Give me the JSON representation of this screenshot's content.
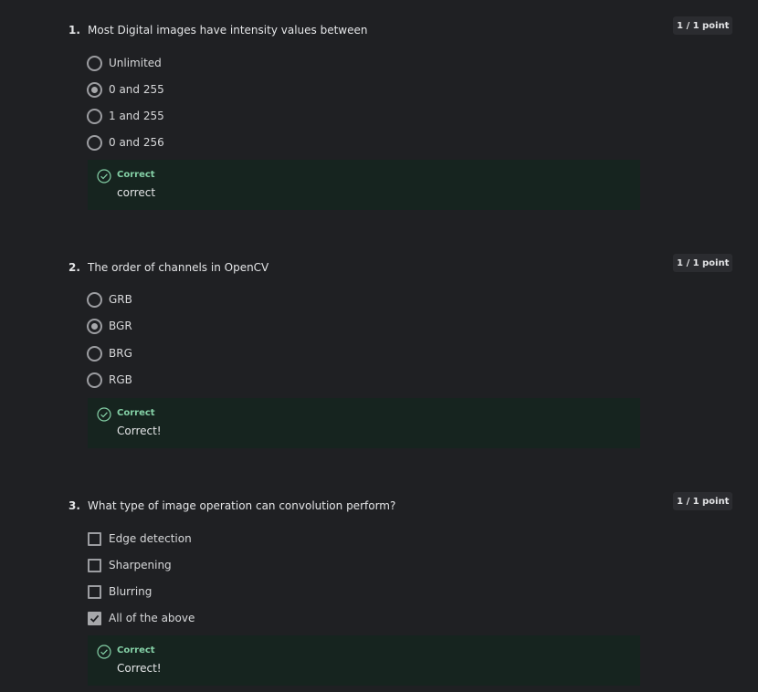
{
  "questions": [
    {
      "number": "1.",
      "text": "Most Digital images have intensity values between",
      "points": "1 / 1 point",
      "type": "radio",
      "options": [
        {
          "label": "Unlimited",
          "checked": false
        },
        {
          "label": "0 and 255",
          "checked": true
        },
        {
          "label": "1 and 255",
          "checked": false
        },
        {
          "label": "0 and 256",
          "checked": false
        }
      ],
      "feedback": {
        "title": "Correct",
        "text": "correct"
      }
    },
    {
      "number": "2.",
      "text": "The order of channels in OpenCV",
      "points": "1 / 1 point",
      "type": "radio",
      "options": [
        {
          "label": "GRB",
          "checked": false
        },
        {
          "label": "BGR",
          "checked": true
        },
        {
          "label": "BRG",
          "checked": false
        },
        {
          "label": "RGB",
          "checked": false
        }
      ],
      "feedback": {
        "title": "Correct",
        "text": "Correct!"
      }
    },
    {
      "number": "3.",
      "text": "What type of image operation can convolution perform?",
      "points": "1 / 1 point",
      "type": "checkbox",
      "options": [
        {
          "label": "Edge detection",
          "checked": false
        },
        {
          "label": "Sharpening",
          "checked": false
        },
        {
          "label": "Blurring",
          "checked": false
        },
        {
          "label": "All of the above",
          "checked": true
        }
      ],
      "feedback": {
        "title": "Correct",
        "text": "Correct!"
      }
    }
  ],
  "colors": {
    "background": "#1f2023",
    "feedback_background": "#16241f",
    "correct_accent": "#84d0a6"
  },
  "icons": {
    "correct": "check-circle-icon",
    "radio": "radio-icon",
    "checkbox": "checkbox-icon"
  }
}
